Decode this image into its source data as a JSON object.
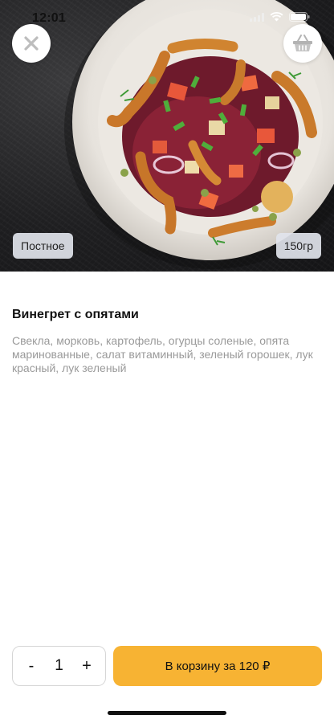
{
  "status_bar": {
    "time": "12:01"
  },
  "dish": {
    "tag_lent": "Постное",
    "weight": "150гр",
    "title": "Винегрет с опятами",
    "description": "Свекла, морковь, картофель, огурцы соленые, опята маринованные, салат витаминный, зеленый горошек, лук красный, лук зеленый"
  },
  "order": {
    "minus_label": "-",
    "quantity": "1",
    "plus_label": "+",
    "add_to_cart_label": "В корзину за 120 ₽"
  },
  "colors": {
    "accent": "#f7b333",
    "tag_bg": "#e1e4eb",
    "muted_text": "#9a9a9a"
  },
  "icons": {
    "close": "close-icon",
    "basket": "basket-icon"
  }
}
